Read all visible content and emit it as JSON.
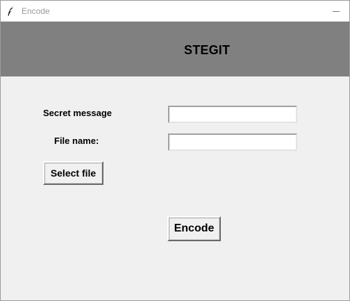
{
  "window": {
    "title": "Encode",
    "icon": "feather-icon",
    "controls": {
      "minimize": "minimize-icon"
    }
  },
  "header": {
    "title": "STEGIT",
    "background": "#808080"
  },
  "form": {
    "secret_message_label": "Secret message",
    "secret_message_value": "",
    "file_name_label": "File name:",
    "file_name_value": "",
    "select_file_label": "Select file"
  },
  "actions": {
    "encode_label": "Encode"
  }
}
